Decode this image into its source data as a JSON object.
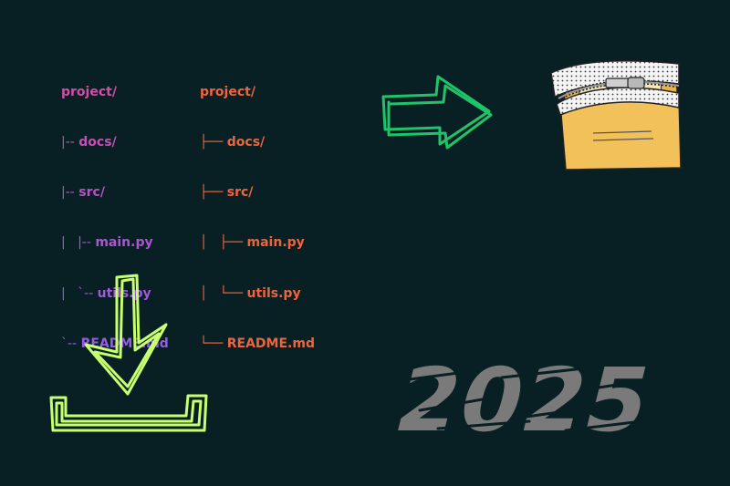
{
  "colors": {
    "background": "#082024",
    "tree_left_gradient": [
      "#d6409f",
      "#9b5de5"
    ],
    "tree_right": "#f0643c",
    "arrow_right": "#1fc46a",
    "download_icon": "#c8ff6e",
    "folder": "#f2c15a",
    "year_text": "#7a7a7a"
  },
  "tree_ascii": {
    "lines": [
      {
        "prefix": "",
        "name": "project/"
      },
      {
        "prefix": "|-- ",
        "name": "docs/"
      },
      {
        "prefix": "|-- ",
        "name": "src/"
      },
      {
        "prefix": "|   |-- ",
        "name": "main.py"
      },
      {
        "prefix": "|   `-- ",
        "name": "utils.py"
      },
      {
        "prefix": "`-- ",
        "name": "README.md"
      }
    ]
  },
  "tree_unicode": {
    "lines": [
      {
        "prefix": "",
        "name": "project/"
      },
      {
        "prefix": "├── ",
        "name": "docs/"
      },
      {
        "prefix": "├── ",
        "name": "src/"
      },
      {
        "prefix": "│   ├── ",
        "name": "main.py"
      },
      {
        "prefix": "│   └── ",
        "name": "utils.py"
      },
      {
        "prefix": "└── ",
        "name": "README.md"
      }
    ]
  },
  "icons": {
    "arrow": "right-arrow-icon",
    "archive": "zip-folder-icon",
    "download": "download-icon"
  },
  "year": "2025"
}
